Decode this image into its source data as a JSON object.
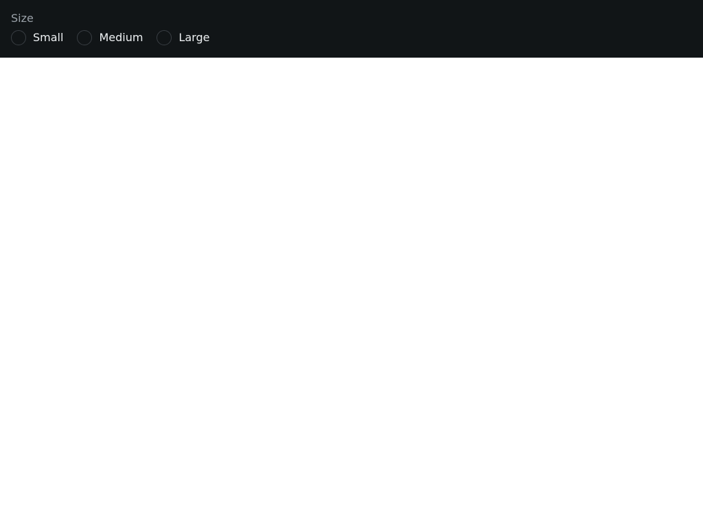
{
  "size_group": {
    "label": "Size",
    "options": [
      {
        "label": "Small",
        "selected": false
      },
      {
        "label": "Medium",
        "selected": false
      },
      {
        "label": "Large",
        "selected": false
      }
    ]
  },
  "colors": {
    "panel_background": "#111517",
    "label_text": "#9aa1a8",
    "option_text": "#eef1f3",
    "radio_border": "#3a3f44",
    "page_background": "#ffffff"
  }
}
